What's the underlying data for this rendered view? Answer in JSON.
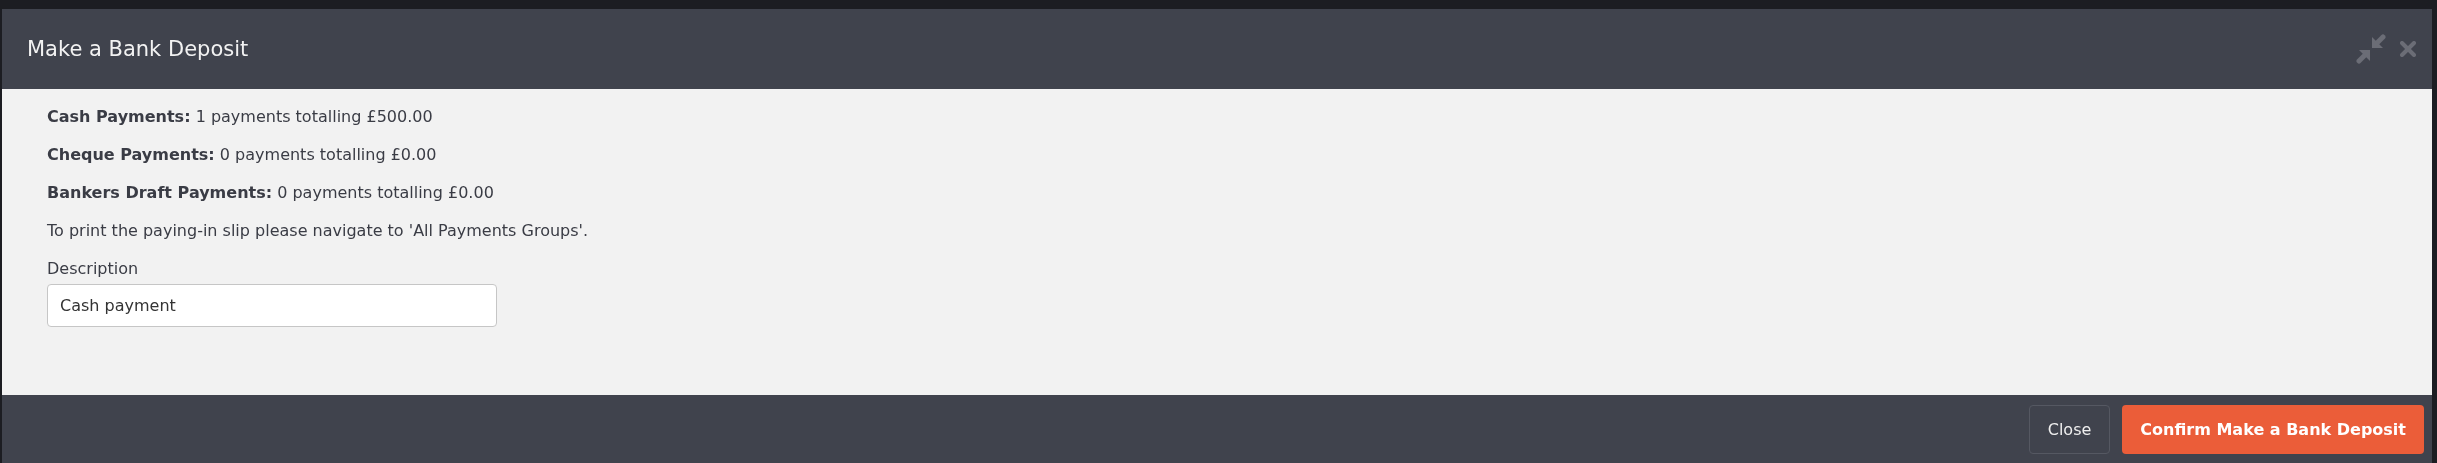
{
  "dialog": {
    "title": "Make a Bank Deposit",
    "summary_lines": [
      "**Cash Payments:** 1 payments totalling £500.00",
      "**Cheque Payments:** 0 payments totalling £0.00",
      "**Bankers Draft Payments:** 0 payments totalling £0.00",
      "To print the paying-in slip please navigate to 'All Payments Groups'."
    ],
    "description": {
      "label": "Description",
      "value": "Cash payment"
    },
    "buttons": [
      {
        "label": "Close",
        "kind": "secondary"
      },
      {
        "label": "Confirm Make a Bank Deposit",
        "kind": "primary"
      }
    ]
  }
}
